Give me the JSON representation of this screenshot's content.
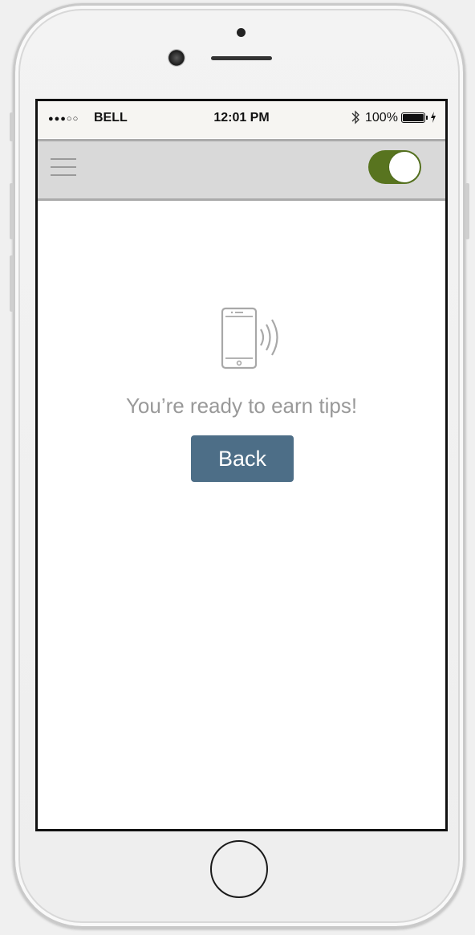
{
  "status_bar": {
    "signal": "●●●○○",
    "carrier": "BELL",
    "time": "12:01 PM",
    "battery_percent": "100%",
    "bluetooth_icon": "bluetooth-icon",
    "battery_icon": "battery-icon",
    "charging_icon": "lightning-icon"
  },
  "header": {
    "menu_icon": "hamburger-menu-icon",
    "toggle_on": true,
    "toggle_color": "#58741f",
    "header_bg": "#d9d9d9"
  },
  "main": {
    "icon": "phone-nfc-signal-icon",
    "message": "You’re ready to earn tips!",
    "back_label": "Back",
    "back_color": "#4d6e87"
  },
  "device": {
    "home_button_icon": "home-button"
  }
}
